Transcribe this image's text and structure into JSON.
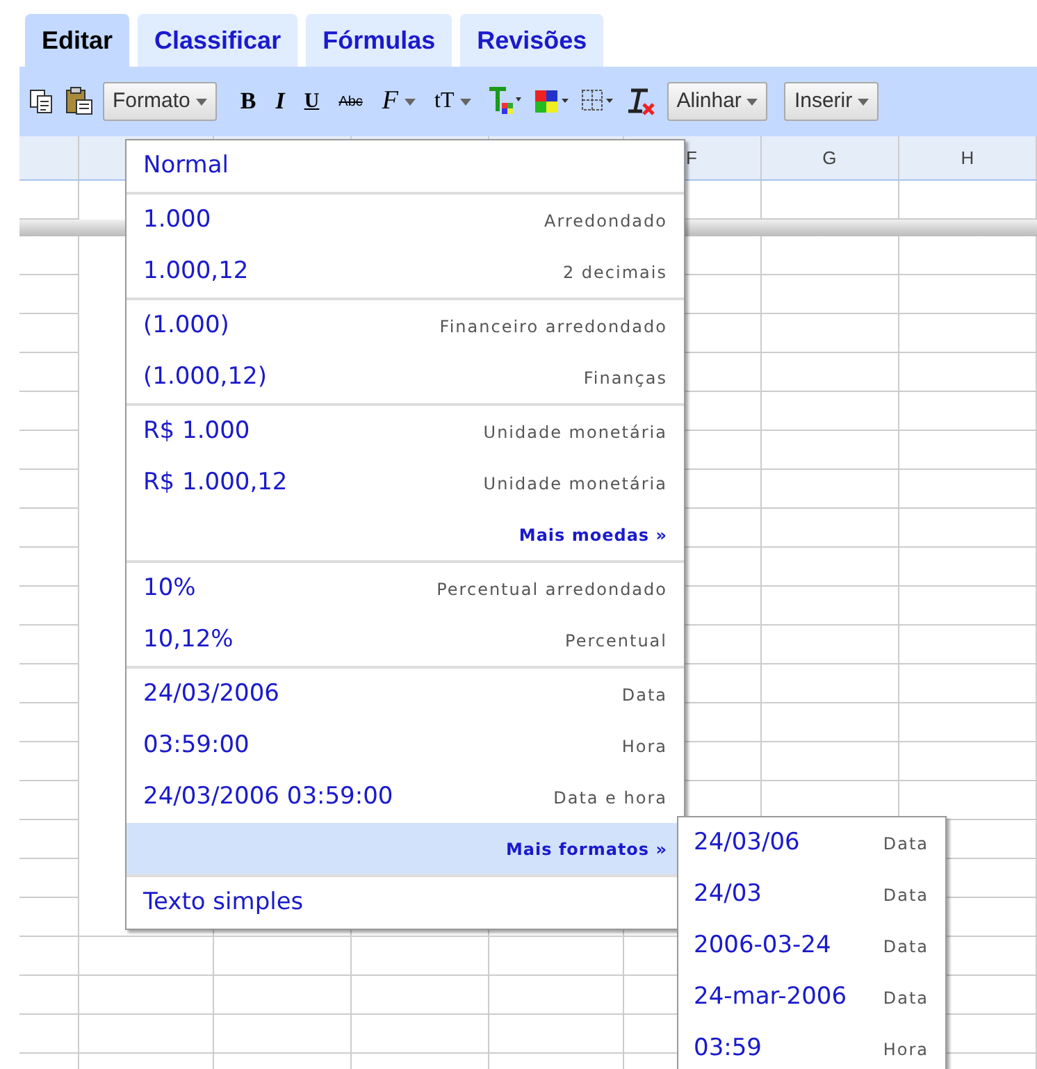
{
  "tabs": [
    {
      "label": "Editar",
      "selected": true
    },
    {
      "label": "Classificar",
      "selected": false
    },
    {
      "label": "Fórmulas",
      "selected": false
    },
    {
      "label": "Revisões",
      "selected": false
    }
  ],
  "toolbar": {
    "format_button": "Formato",
    "glyphs": [
      "B",
      "I",
      "U",
      "Abc",
      "F",
      "tT"
    ],
    "align_button": "Alinhar",
    "insert_button": "Inserir"
  },
  "columns": [
    {
      "label": "F"
    },
    {
      "label": "G"
    },
    {
      "label": "H"
    }
  ],
  "format_menu": {
    "sections": [
      [
        {
          "kind": "plain",
          "label": "Normal",
          "selected": false
        }
      ],
      [
        {
          "kind": "format",
          "label": "1.000",
          "description": "Arredondado",
          "selected": false
        },
        {
          "kind": "format",
          "label": "1.000,12",
          "description": "2 decimais",
          "selected": false
        }
      ],
      [
        {
          "kind": "format",
          "label": "(1.000)",
          "description": "Financeiro arredondado",
          "selected": false
        },
        {
          "kind": "format",
          "label": "(1.000,12)",
          "description": "Finanças",
          "selected": false
        }
      ],
      [
        {
          "kind": "format",
          "label": "R$ 1.000",
          "description": "Unidade monetária",
          "selected": false
        },
        {
          "kind": "format",
          "label": "R$ 1.000,12",
          "description": "Unidade monetária",
          "selected": false
        },
        {
          "kind": "more",
          "label": "Mais moedas »",
          "selected": false
        }
      ],
      [
        {
          "kind": "format",
          "label": "10%",
          "description": "Percentual arredondado",
          "selected": false
        },
        {
          "kind": "format",
          "label": "10,12%",
          "description": "Percentual",
          "selected": false
        }
      ],
      [
        {
          "kind": "format",
          "label": "24/03/2006",
          "description": "Data",
          "selected": false
        },
        {
          "kind": "format",
          "label": "03:59:00",
          "description": "Hora",
          "selected": false
        },
        {
          "kind": "format",
          "label": "24/03/2006 03:59:00",
          "description": "Data e hora",
          "selected": false
        },
        {
          "kind": "more",
          "label": "Mais formatos »",
          "selected": true
        }
      ],
      [
        {
          "kind": "plain",
          "label": "Texto simples",
          "selected": false
        }
      ]
    ]
  },
  "submenu": {
    "items": [
      {
        "label": "24/03/06",
        "description": "Data"
      },
      {
        "label": "24/03",
        "description": "Data"
      },
      {
        "label": "2006-03-24",
        "description": "Data"
      },
      {
        "label": "24-mar-2006",
        "description": "Data"
      },
      {
        "label": "03:59",
        "description": "Hora"
      }
    ]
  }
}
